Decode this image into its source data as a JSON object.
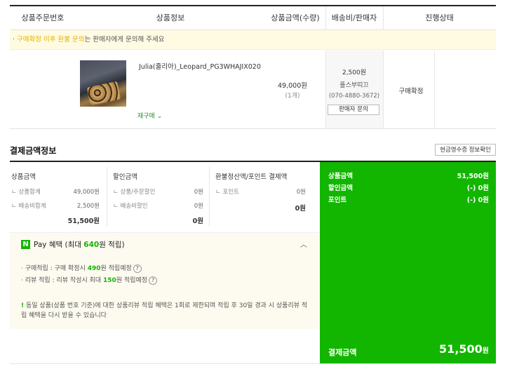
{
  "table_header": {
    "order_no": "상품주문번호",
    "product_info": "상품정보",
    "amount_qty": "상품금액(수량)",
    "shipping_seller": "배송비/판매자",
    "progress": "진행상태"
  },
  "notice": {
    "prefix": "· ",
    "highlight": "구매확정 이후 환불 문의",
    "rest": "는 판매자에게 문의해 주세요"
  },
  "order_item": {
    "name": "Julia(줄리아)_Leopard_PG3WHAJIX020",
    "rebuy_label": "재구매",
    "price": "49,000원",
    "qty": "(1개)",
    "shipping_fee": "2,500원",
    "seller": "플스부띠끄",
    "seller_phone": "(070-4880-3672)",
    "seller_inquiry": "판매자 문의",
    "status": "구매확정"
  },
  "payment": {
    "title": "결제금액정보",
    "receipt_button": "현금영수증 정보확인",
    "product_amount": {
      "header": "상품금액",
      "items": [
        {
          "label": "ㄴ 상품합계",
          "value": "49,000원"
        },
        {
          "label": "ㄴ 배송비합계",
          "value": "2,500원"
        }
      ],
      "total": "51,500원"
    },
    "discount": {
      "header": "할인금액",
      "items": [
        {
          "label": "ㄴ 상품/주문할인",
          "value": "0원"
        },
        {
          "label": "ㄴ 배송비할인",
          "value": "0원"
        }
      ],
      "total": "0원"
    },
    "refund": {
      "header": "환불정산액/포인트 결제액",
      "items": [
        {
          "label": "ㄴ 포인트",
          "value": "0원"
        }
      ],
      "total": "0원"
    },
    "summary": {
      "rows": [
        {
          "label": "상품금액",
          "value": "51,500원"
        },
        {
          "label": "할인금액",
          "value": "(-) 0원"
        },
        {
          "label": "포인트",
          "value": "(-) 0원"
        }
      ],
      "total_label": "결제금액",
      "total_value": "51,500",
      "total_unit": "원"
    }
  },
  "npay": {
    "logo": "N",
    "title_pre": "Pay 혜택 (최대 ",
    "title_num": "640",
    "title_post": "원 적립)",
    "benefits": [
      {
        "pre": "· 구매적립 : 구매 확정시 ",
        "num": "490",
        "post": "원 적립예정"
      },
      {
        "pre": "· 리뷰 적립 : 리뷰 작성시 최대 ",
        "num": "150",
        "post": "원 적립예정"
      }
    ],
    "help": "?",
    "warning_mark": "!",
    "warning": " 동일 상품(상품 번호 기준)에 대한 상품리뷰 적립 혜택은 1회로 제한되며 적립 후 30일 경과 시 상품리뷰 적립 혜택을 다시 받을 수 있습니다"
  },
  "colors": {
    "accent": "#12b600",
    "notice_bg": "#fffbe3",
    "highlight": "#e5b100"
  }
}
